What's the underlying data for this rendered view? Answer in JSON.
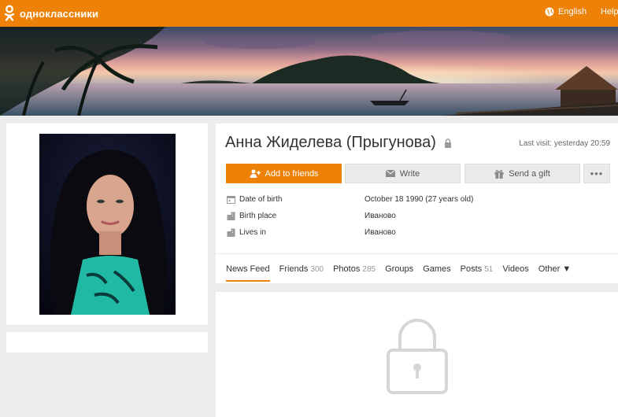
{
  "header": {
    "site_name": "одноклассники",
    "language_label": "English",
    "help_label": "Help"
  },
  "profile": {
    "name": "Анна Жиделева (Прыгунова)",
    "last_visit": "Last visit: yesterday 20:59",
    "actions": {
      "add_friend": "Add to friends",
      "write": "Write",
      "gift": "Send a gift",
      "more": "•••"
    },
    "info": [
      {
        "label": "Date of birth",
        "value": "October 18 1990 (27 years old)",
        "icon": "calendar-icon"
      },
      {
        "label": "Birth place",
        "value": "Иваново",
        "icon": "building-icon"
      },
      {
        "label": "Lives in",
        "value": "Иваново",
        "icon": "building-icon"
      }
    ]
  },
  "tabs": [
    {
      "label": "News Feed",
      "count": ""
    },
    {
      "label": "Friends",
      "count": "300"
    },
    {
      "label": "Photos",
      "count": "285"
    },
    {
      "label": "Groups",
      "count": ""
    },
    {
      "label": "Games",
      "count": ""
    },
    {
      "label": "Posts",
      "count": "51"
    },
    {
      "label": "Videos",
      "count": ""
    },
    {
      "label": "Other ▼",
      "count": ""
    }
  ],
  "colors": {
    "brand": "#ee8208",
    "page_bg": "#ececec"
  }
}
